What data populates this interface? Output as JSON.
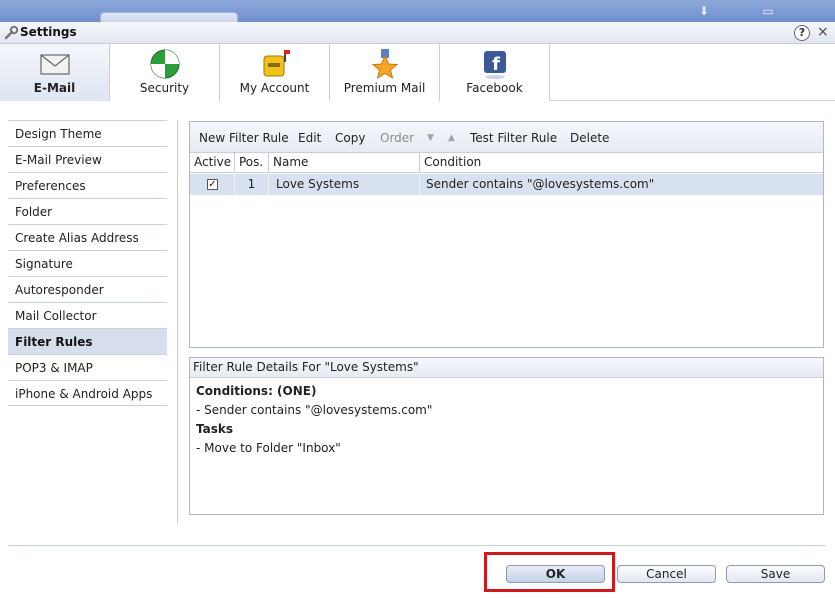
{
  "window": {
    "title": "Settings",
    "help_label": "?",
    "close_label": "×"
  },
  "categories": [
    {
      "label": "E-Mail",
      "icon": "envelope-icon",
      "active": true
    },
    {
      "label": "Security",
      "icon": "shield-icon",
      "active": false
    },
    {
      "label": "My Account",
      "icon": "mailbox-icon",
      "active": false
    },
    {
      "label": "Premium Mail",
      "icon": "star-medal-icon",
      "active": false
    },
    {
      "label": "Facebook",
      "icon": "facebook-icon",
      "active": false
    }
  ],
  "nav": {
    "items": [
      {
        "label": "Design Theme"
      },
      {
        "label": "E-Mail Preview"
      },
      {
        "label": "Preferences"
      },
      {
        "label": "Folder"
      },
      {
        "label": "Create Alias Address"
      },
      {
        "label": "Signature"
      },
      {
        "label": "Autoresponder"
      },
      {
        "label": "Mail Collector"
      },
      {
        "label": "Filter Rules",
        "selected": true
      },
      {
        "label": "POP3 & IMAP"
      },
      {
        "label": "iPhone & Android Apps"
      }
    ]
  },
  "toolbar": {
    "new": "New Filter Rule",
    "edit": "Edit",
    "copy": "Copy",
    "order": "Order",
    "test": "Test Filter Rule",
    "delete": "Delete"
  },
  "table": {
    "headers": [
      "Active",
      "Pos.",
      "Name",
      "Condition"
    ],
    "rows": [
      {
        "active": true,
        "pos": "1",
        "name": "Love Systems",
        "condition": "Sender contains \"@lovesystems.com\""
      }
    ]
  },
  "details": {
    "header": "Filter Rule Details For \"Love Systems\"",
    "conditions_heading": "Conditions: (ONE)",
    "condition_line": "- Sender contains \"@lovesystems.com\"",
    "tasks_heading": "Tasks",
    "task_line": "- Move to Folder \"Inbox\""
  },
  "buttons": {
    "ok": "OK",
    "cancel": "Cancel",
    "save": "Save"
  },
  "colors": {
    "highlight_box": "#d0191f",
    "selection": "#d8e1ef"
  }
}
